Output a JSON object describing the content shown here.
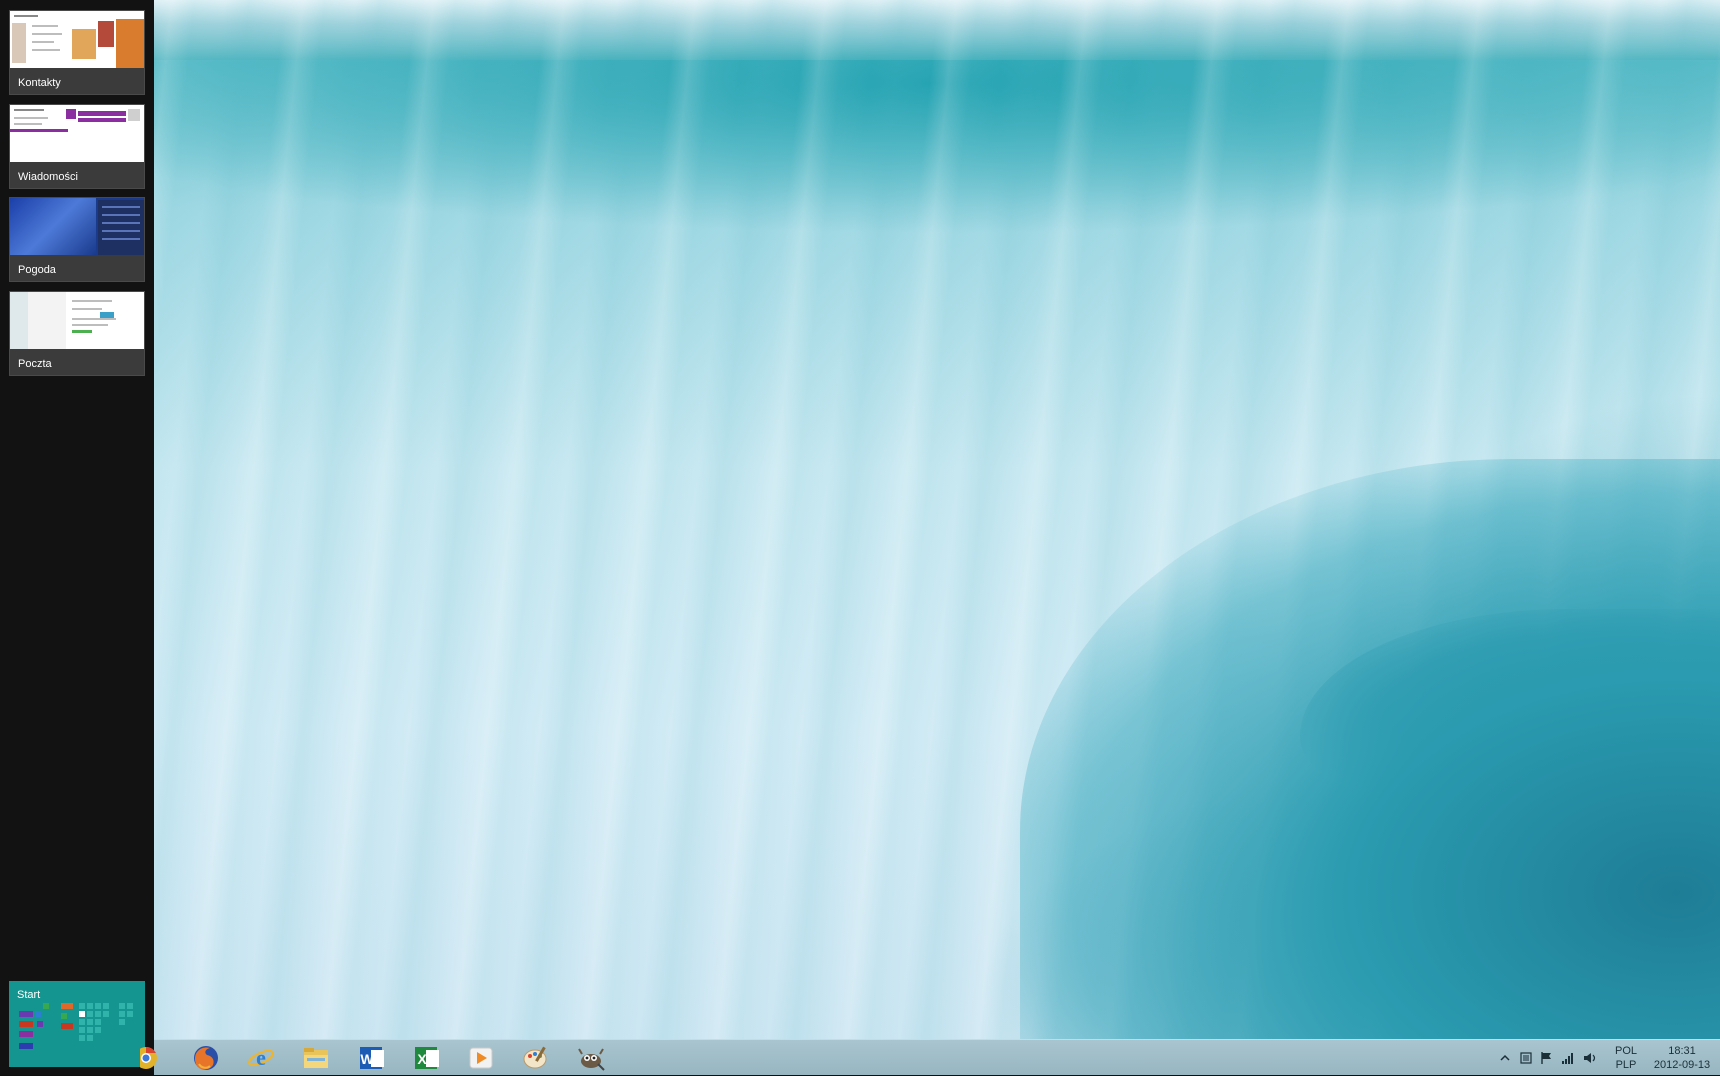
{
  "switcher": {
    "apps": [
      {
        "label": "Kontakty"
      },
      {
        "label": "Wiadomości"
      },
      {
        "label": "Pogoda"
      },
      {
        "label": "Poczta"
      }
    ],
    "start_label": "Start"
  },
  "taskbar": {
    "pinned": [
      {
        "icon": "chrome-icon"
      },
      {
        "icon": "firefox-icon"
      },
      {
        "icon": "internet-explorer-icon"
      },
      {
        "icon": "file-explorer-icon"
      },
      {
        "icon": "word-icon"
      },
      {
        "icon": "excel-icon"
      },
      {
        "icon": "media-player-icon"
      },
      {
        "icon": "paint-icon"
      },
      {
        "icon": "gimp-icon"
      }
    ],
    "tray": {
      "language_line1": "POL",
      "language_line2": "PLP",
      "time": "18:31",
      "date": "2012-09-13"
    }
  },
  "colors": {
    "start_tile": "#15958f",
    "switcher_bg": "#121212",
    "taskbar": "#a9c5cf"
  }
}
